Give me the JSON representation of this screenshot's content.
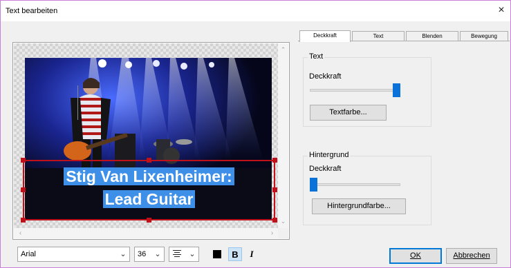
{
  "window": {
    "title": "Text bearbeiten",
    "close_glyph": "×"
  },
  "preview": {
    "overlay_text": [
      "Stig Van Lixenheimer:",
      "Lead Guitar"
    ],
    "selection_color": "#c0101a",
    "text_highlight_color": "#3d8fe8"
  },
  "format_toolbar": {
    "font": "Arial",
    "size": "36",
    "align_icon": "align-lines-icon",
    "color": "#000000",
    "bold_label": "B",
    "italic_label": "I"
  },
  "tabs": [
    {
      "label": "Deckkraft",
      "active": true
    },
    {
      "label": "Text",
      "active": false
    },
    {
      "label": "Blenden",
      "active": false
    },
    {
      "label": "Bewegung",
      "active": false
    }
  ],
  "text_group": {
    "title": "Text",
    "opacity_label": "Deckkraft",
    "opacity_value": 1.0,
    "color_button": "Textfarbe..."
  },
  "background_group": {
    "title": "Hintergrund",
    "opacity_label": "Deckkraft",
    "opacity_value": 0.0,
    "color_button": "Hintergrundfarbe..."
  },
  "dialog_buttons": {
    "ok": "OK",
    "cancel": "Abbrechen"
  },
  "colors": {
    "accent": "#0a72d8",
    "window_border": "#c97fd7"
  }
}
